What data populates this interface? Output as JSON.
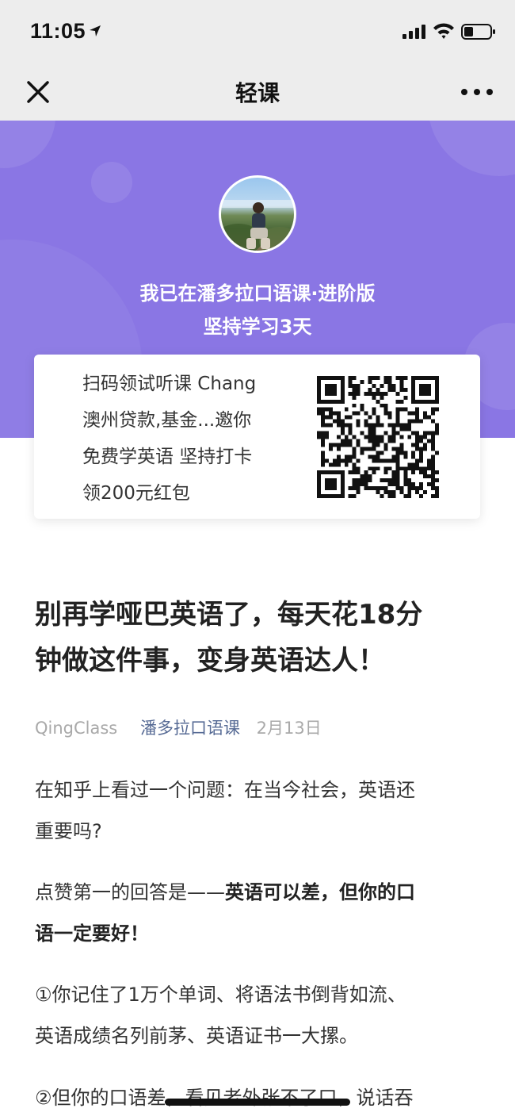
{
  "status_bar": {
    "time": "11:05",
    "icons": [
      "location-arrow-icon",
      "cellular-signal-icon",
      "wifi-icon",
      "battery-icon"
    ]
  },
  "nav": {
    "title": "轻课",
    "close_icon": "close-icon",
    "more_icon": "more-icon"
  },
  "hero": {
    "line1": "我已在潘多拉口语课·进阶版",
    "line2": "坚持学习3天",
    "background_color": "#8a76e4"
  },
  "invite_card": {
    "lines": [
      "扫码领试听课 Chang",
      "澳州贷款,基金...邀你",
      "免费学英语 坚持打卡",
      "领200元红包"
    ]
  },
  "article": {
    "title_lines": [
      "别再学哑巴英语了，每天花18分",
      "钟做这件事，变身英语达人！"
    ],
    "source": "QingClass",
    "author": "潘多拉口语课",
    "date": "2月13日",
    "para1_lines": [
      "在知乎上看过一个问题：在当今社会，英语还",
      "重要吗?"
    ],
    "para2_line1_plain": "点赞第一的回答是——",
    "para2_line1_bold": "英语可以差，但你的口",
    "para2_line2_bold": "语一定要好！",
    "para3_lines": [
      "①你记住了1万个单词、将语法书倒背如流、",
      "英语成绩名列前茅、英语证书一大摞。"
    ],
    "para4_line1": "②但你的口语差，看见老外张不了口，说话吞"
  },
  "colors": {
    "link": "#576b95",
    "meta_gray": "#a9a9a9"
  }
}
